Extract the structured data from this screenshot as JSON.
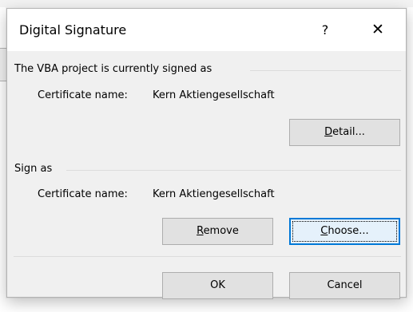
{
  "dialog": {
    "title": "Digital Signature",
    "help_glyph": "?",
    "close_glyph": "✕"
  },
  "current_signature": {
    "heading": "The VBA project is currently signed as",
    "certificate_label": "Certificate name:",
    "certificate_name": "Kern Aktiengesellschaft",
    "detail_button": {
      "prefix": "",
      "mnemonic": "D",
      "suffix": "etail..."
    }
  },
  "sign_as": {
    "heading": "Sign as",
    "certificate_label": "Certificate name:",
    "certificate_name": "Kern Aktiengesellschaft",
    "remove_button": {
      "prefix": "",
      "mnemonic": "R",
      "suffix": "emove"
    },
    "choose_button": {
      "prefix": "",
      "mnemonic": "C",
      "suffix": "hoose..."
    }
  },
  "footer": {
    "ok_label": "OK",
    "cancel_label": "Cancel"
  },
  "colors": {
    "dialog_bg": "#f0f0f0",
    "button_bg": "#e1e1e1",
    "focus_accent": "#0078d7"
  },
  "icons": {
    "help": "question-mark-icon",
    "close": "close-x-icon"
  }
}
